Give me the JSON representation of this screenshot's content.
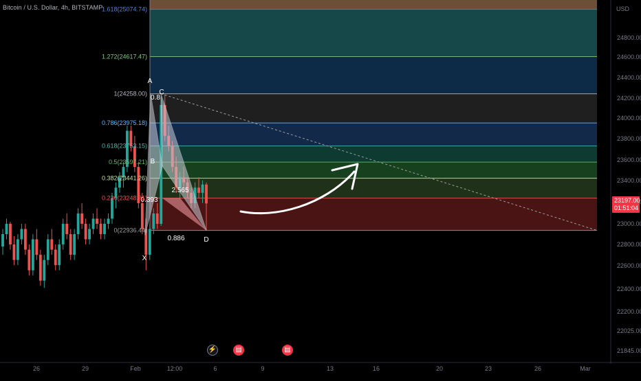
{
  "header": {
    "title": "Bitcoin / U.S. Dollar, 4h, BITSTAMP",
    "currency": "USD"
  },
  "last_price": {
    "value": "23197.00",
    "countdown": "01:51:04"
  },
  "events": [
    {
      "name": "flash-event-icon",
      "glyph": "⚡",
      "kind": "flash",
      "x": "Feb 5"
    },
    {
      "name": "us-flag-event-icon-1",
      "glyph": "▤",
      "kind": "flag",
      "x": "Feb 7"
    },
    {
      "name": "us-flag-event-icon-2",
      "glyph": "▤",
      "kind": "flag",
      "x": "Feb 10"
    }
  ],
  "colors": {
    "background": "#000000",
    "up_candle": "#26a69a",
    "down_candle": "#ef5350",
    "price_tag": "#f23645",
    "pattern_fill": "#c8ccd6",
    "pattern_fill_red": "#f7a1a8",
    "arrow": "#ffffff"
  },
  "chart_data": {
    "type": "candlestick",
    "symbol": "Bitcoin / U.S. Dollar",
    "interval": "4h",
    "exchange": "BITSTAMP",
    "y_axis": {
      "ticks": [
        "24800.00",
        "24600.00",
        "24400.00",
        "24200.00",
        "24000.00",
        "23800.00",
        "23600.00",
        "23400.00",
        "23200.00",
        "23000.00",
        "22800.00",
        "22600.00",
        "22400.00",
        "22200.00",
        "22025.00",
        "21845.00"
      ],
      "unit": "USD"
    },
    "x_axis": {
      "ticks": [
        "26",
        "29",
        "Feb",
        "12:00",
        "6",
        "9",
        "13",
        "16",
        "20",
        "23",
        "26",
        "Mar"
      ]
    },
    "fib_levels": [
      {
        "ratio": "1.618",
        "price": "25074.74",
        "label": "1.618(25074.74)",
        "color": "#4f83d4",
        "fill": "#6b4f36"
      },
      {
        "ratio": "1.272",
        "price": "24617.47",
        "label": "1.272(24617.47)",
        "color": "#81c784",
        "fill": "#16484a"
      },
      {
        "ratio": "1",
        "price": "24258.00",
        "label": "1(24258.00)",
        "color": "#b2b5be",
        "fill": "#0d2a47"
      },
      {
        "ratio": "0.786",
        "price": "23975.18",
        "label": "0.786(23975.18)",
        "color": "#64b5f6",
        "fill": "#1f1f1f"
      },
      {
        "ratio": "0.618",
        "price": "23753.15",
        "label": "0.618(23753.15)",
        "color": "#4db6ac",
        "fill": "#12294a"
      },
      {
        "ratio": "0.5",
        "price": "23597.21",
        "label": "0.5(23597.21)",
        "color": "#66bb6a",
        "fill": "#0d3a31"
      },
      {
        "ratio": "0.382",
        "price": "23441.26",
        "label": "0.382(23441.26)",
        "color": "#c5e1a5",
        "fill": "#17401f"
      },
      {
        "ratio": "0.236",
        "price": "23248.31",
        "label": "0.236(23248.31)",
        "color": "#ef5350",
        "fill": "#1f3219"
      },
      {
        "ratio": "0",
        "price": "22936.44",
        "label": "0(22936.44)",
        "color": "#9e9e9e",
        "fill": "#4a1414"
      }
    ],
    "harmonic_pattern": {
      "points": [
        {
          "label": "X",
          "price": 22890
        },
        {
          "label": "A",
          "price": 24258
        },
        {
          "label": "B",
          "price": 23560
        },
        {
          "label": "C",
          "price": 24258
        },
        {
          "label": "D",
          "price": 22936
        }
      ],
      "ratios": [
        {
          "label": "0.393"
        },
        {
          "label": "0.886"
        },
        {
          "label": "2.565"
        },
        {
          "label": "0.8"
        }
      ]
    },
    "projection_line": {
      "from_price": 24258,
      "to_price": 22936,
      "style": "dashed"
    },
    "candles": [
      [
        22780,
        22950,
        22700,
        22900
      ],
      [
        22900,
        23050,
        22850,
        23000
      ],
      [
        23000,
        23020,
        22750,
        22800
      ],
      [
        22800,
        22880,
        22600,
        22650
      ],
      [
        22650,
        22900,
        22600,
        22850
      ],
      [
        22850,
        23000,
        22800,
        22950
      ],
      [
        22950,
        23000,
        22700,
        22750
      ],
      [
        22750,
        22800,
        22500,
        22550
      ],
      [
        22550,
        22900,
        22500,
        22850
      ],
      [
        22850,
        22950,
        22650,
        22700
      ],
      [
        22700,
        22750,
        22400,
        22450
      ],
      [
        22450,
        22700,
        22380,
        22650
      ],
      [
        22650,
        22900,
        22600,
        22850
      ],
      [
        22850,
        22950,
        22700,
        22750
      ],
      [
        22750,
        22800,
        22550,
        22600
      ],
      [
        22600,
        22850,
        22550,
        22800
      ],
      [
        22800,
        23050,
        22750,
        23000
      ],
      [
        23000,
        23100,
        22850,
        22900
      ],
      [
        22900,
        22950,
        22650,
        22700
      ],
      [
        22700,
        22950,
        22650,
        22900
      ],
      [
        22900,
        23150,
        22850,
        23100
      ],
      [
        23100,
        23200,
        22950,
        23000
      ],
      [
        23000,
        23050,
        22800,
        22850
      ],
      [
        22850,
        23000,
        22800,
        22950
      ],
      [
        22950,
        23100,
        22900,
        23050
      ],
      [
        23050,
        23150,
        22950,
        23000
      ],
      [
        23000,
        23050,
        22850,
        22900
      ],
      [
        22900,
        23050,
        22850,
        23000
      ],
      [
        23000,
        23100,
        22950,
        23050
      ],
      [
        23050,
        23300,
        23000,
        23250
      ],
      [
        23250,
        23400,
        23150,
        23350
      ],
      [
        23350,
        23500,
        23300,
        23450
      ],
      [
        23450,
        23600,
        23350,
        23550
      ],
      [
        23550,
        23950,
        23500,
        23900
      ],
      [
        23900,
        23950,
        23700,
        23750
      ],
      [
        23750,
        23850,
        23500,
        23550
      ],
      [
        23550,
        23600,
        23150,
        23200
      ],
      [
        23200,
        23300,
        22900,
        22950
      ],
      [
        22950,
        23050,
        22550,
        22700
      ],
      [
        22700,
        23000,
        22650,
        22950
      ],
      [
        22950,
        23150,
        22900,
        23100
      ],
      [
        23100,
        23200,
        22950,
        23000
      ],
      [
        23000,
        24230,
        22980,
        24150
      ],
      [
        24150,
        24250,
        23800,
        23850
      ],
      [
        23850,
        23950,
        23700,
        23750
      ],
      [
        23750,
        23800,
        23500,
        23550
      ],
      [
        23550,
        23650,
        23300,
        23350
      ],
      [
        23350,
        23500,
        23250,
        23450
      ],
      [
        23450,
        23550,
        23300,
        23400
      ],
      [
        23400,
        23450,
        23250,
        23300
      ],
      [
        23300,
        23350,
        23150,
        23200
      ],
      [
        23200,
        23400,
        23150,
        23350
      ],
      [
        23350,
        23450,
        23250,
        23300
      ],
      [
        23300,
        23420,
        23200,
        23380
      ],
      [
        23380,
        23400,
        22940,
        23197
      ]
    ]
  }
}
